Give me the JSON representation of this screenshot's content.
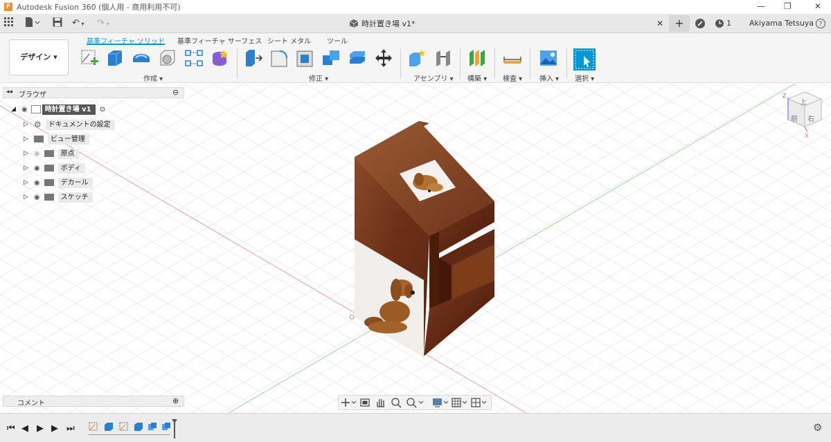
{
  "window": {
    "title": "Autodesk Fusion 360 (個人用 - 商用利用不可)",
    "logo": "F"
  },
  "appbar": {
    "doc_title": "時計置き場 v1*",
    "job_count": "1",
    "user_name": "Akiyama Tetsuya"
  },
  "toolbar": {
    "workspace": "デザイン ▾",
    "tabs": [
      "基準フィーチャ ソリッド",
      "基準フィーチャ サーフェス",
      "シート メタル",
      "ツール"
    ],
    "groups": [
      "作成 ▾",
      "修正 ▾",
      "アセンブリ ▾",
      "構築 ▾",
      "検査 ▾",
      "挿入 ▾",
      "選択 ▾"
    ]
  },
  "browser": {
    "title": "ブラウザ",
    "root": "時計置き場 v1",
    "items": [
      "ドキュメントの設定",
      "ビュー管理",
      "原点",
      "ボディ",
      "デカール",
      "スケッチ"
    ]
  },
  "comments": {
    "title": "コメント"
  },
  "viewcube": {
    "top": "上",
    "front": "前",
    "right": "右",
    "axis_x": "X",
    "axis_z": "Z"
  },
  "colors": {
    "accent": "#0696d7",
    "wood": "#7a3b1d",
    "wood_dark": "#4e2010",
    "orange_logo": "#f28c28"
  }
}
